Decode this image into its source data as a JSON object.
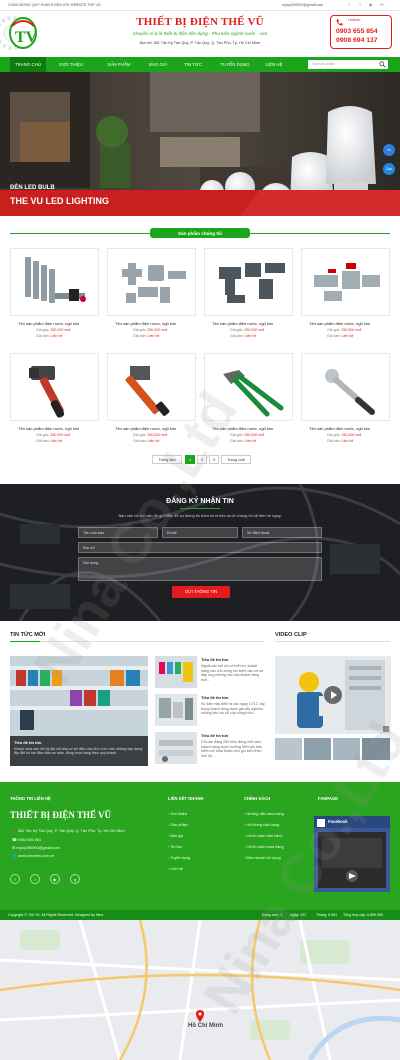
{
  "topbar": {
    "welcome": "CHÀO MỪNG QUÝ KHÁCH ĐẾN VỚI WEBSITE THẾ VŨ",
    "email": "mywy250000@gmail.com",
    "socials": [
      "f",
      "t",
      "▶",
      "G+"
    ]
  },
  "header": {
    "logo_text": "TV",
    "brand": "THIẾT BỊ ĐIỆN THẾ VŨ",
    "tagline": "Chuyên sỉ & lẻ thiết bị điện dân dụng - Phụ kiện ngành nước - sơn",
    "address": "Địa chỉ: 361 Tân Kỳ Tân Quý, P. Tân Quý, Q. Tân Phú, Tp. Hồ Chí Minh",
    "hotline_label": "Hotline:",
    "phone1": "0903 655 854",
    "phone2": "0908 694 137"
  },
  "nav": {
    "items": [
      "TRANG CHỦ",
      "GIỚI THIỆU",
      "SẢN PHẨM",
      "BÁO GIÁ",
      "TIN TỨC",
      "TUYỂN DỤNG",
      "LIÊN HỆ"
    ],
    "search_placeholder": "Tìm sản phẩm"
  },
  "banner": {
    "line1": "ĐÈN LED BULB",
    "line2": "THE VU LED LIGHTING",
    "messenger": "m",
    "zalo": "Zalo"
  },
  "products": {
    "title": "Sản phẩm chúng tôi",
    "items": [
      {
        "name": "Tên sản phẩm điện nước, ngũ kim",
        "old_label": "Giá gốc:",
        "old": "250.000 vnđ",
        "price_label": "Giá bán:",
        "price": "Liên hệ"
      },
      {
        "name": "Tên sản phẩm điện nước, ngũ kim",
        "old_label": "Giá gốc:",
        "old": "250.000 vnđ",
        "price_label": "Giá bán:",
        "price": "Liên hệ"
      },
      {
        "name": "Tên sản phẩm điện nước, ngũ kim",
        "old_label": "Giá gốc:",
        "old": "250.000 vnđ",
        "price_label": "Giá bán:",
        "price": "Liên hệ"
      },
      {
        "name": "Tên sản phẩm điện nước, ngũ kim",
        "old_label": "Giá gốc:",
        "old": "250.000 vnđ",
        "price_label": "Giá bán:",
        "price": "Liên hệ"
      },
      {
        "name": "Tên sản phẩm điện nước, ngũ kim",
        "old_label": "Giá gốc:",
        "old": "250.000 vnđ",
        "price_label": "Giá bán:",
        "price": "Liên hệ"
      },
      {
        "name": "Tên sản phẩm điện nước, ngũ kim",
        "old_label": "Giá gốc:",
        "old": "250.000 vnđ",
        "price_label": "Giá bán:",
        "price": "Liên hệ"
      },
      {
        "name": "Tên sản phẩm điện nước, ngũ kim",
        "old_label": "Giá gốc:",
        "old": "250.000 vnđ",
        "price_label": "Giá bán:",
        "price": "Liên hệ"
      },
      {
        "name": "Tên sản phẩm điện nước, ngũ kim",
        "old_label": "Giá gốc:",
        "old": "250.000 vnđ",
        "price_label": "Giá bán:",
        "price": "Liên hệ"
      }
    ],
    "pagination": [
      "Trang đầu",
      "1",
      "2",
      "3",
      "Trang cuối"
    ]
  },
  "subscribe": {
    "title": "ĐĂNG KÝ NHẬN TIN",
    "desc": "Bạn cần hỗ trợ vấn đề gì? Hãy để lại thông tin theo form bên dưới chúng tôi sẽ liên hệ ngay.",
    "name_ph": "Tên của bạn",
    "email_ph": "Email",
    "phone_ph": "Số điện thoại",
    "address_ph": "Địa chỉ",
    "content_ph": "Nội dung",
    "button": "GỬI THÔNG TIN"
  },
  "news": {
    "title": "TIN TỨC MỚI",
    "main_title": "Tiêu đề tin tức",
    "main_desc": "Khách mua cần hỏi kỹ địa chỉ của cơ sở điện của đơn vị tư vấn, không xây dựng lắp đặt hồ bơi đảm bảo an toàn, đồng mua hàng theo quý khách.",
    "items": [
      {
        "title": "Tiêu đề tin tức",
        "desc": "Ngoài các kết nối với bể bơi, khách hàng cần chú trọng tìm kiếm các cơ sở đáp ứng những nhu cầu khách hàng mới..."
      },
      {
        "title": "Tiêu đề tin tức",
        "desc": "Sự kiện này diễn ra vào ngày 17/12, tập trung khách hàng tham gia xây nghiệm những tiêu chí tốt của công trình..."
      },
      {
        "title": "Tiêu đề tin tức",
        "desc": "Chỉ cần đăng 250 triệu đồng mỗi năm, khách hàng được hưởng 50% phí bảo hiểm với thỏa thuận trọn gói kèm theo mỗi hộ..."
      }
    ]
  },
  "video": {
    "title": "VIDEO CLIP"
  },
  "footer": {
    "info_title": "THÔNG TIN LIÊN HỆ",
    "brand": "THIẾT BỊ ĐIỆN THẾ VŨ",
    "address": "361 Tân Kỳ Tân Quý, P. Tân Quý, Q. Tân Phú, Tp. Hồ Chí Minh",
    "phone": "0903 655 854",
    "email": "mywy250000@gmail.com",
    "website": "www.tvinmien.com.vn",
    "links_title": "LIÊN KẾT NHANH",
    "links": [
      "Giới thiệu",
      "Sản phẩm",
      "Báo giá",
      "Tin tức",
      "Tuyển dụng",
      "Liên hệ"
    ],
    "policy_title": "CHÍNH SÁCH",
    "policies": [
      "Hướng dẫn mua hàng",
      "Hệ thống cửa hàng",
      "Chính sách bảo hành",
      "Chính sách mua hàng",
      "Điều khoản sử dụng"
    ],
    "fanpage_title": "FANPAGE",
    "fb_label": "Facebook"
  },
  "copyright": {
    "text": "Copyright © Thế Vũ. All Rights Reserved. Designed by Nina",
    "stats": [
      "Đang xem: 3",
      "Ngày: 437",
      "Tháng: 5.961",
      "Tổng truy cập: 6.899.399"
    ]
  },
  "map": {
    "city": "Hồ Chí Minh"
  },
  "watermark": "Nina Co.,Ltd"
}
